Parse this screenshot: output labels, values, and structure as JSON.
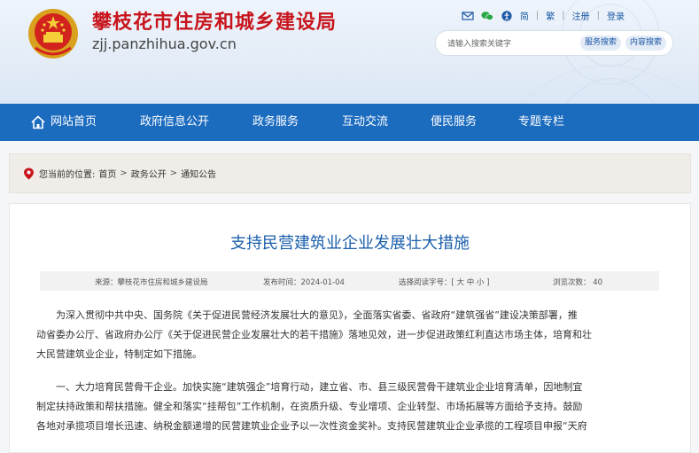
{
  "header": {
    "title": "攀枝花市住房和城乡建设局",
    "domain": "zjj.panzhihua.gov.cn",
    "links": {
      "simplified": "简",
      "traditional": "繁",
      "register": "注册",
      "login": "登录",
      "sep": "|"
    },
    "search": {
      "placeholder": "请输入搜索关键字",
      "service_search": "服务搜索",
      "content_search": "内容搜索"
    }
  },
  "nav": {
    "items": [
      {
        "label": "网站首页"
      },
      {
        "label": "政府信息公开"
      },
      {
        "label": "政务服务"
      },
      {
        "label": "互动交流"
      },
      {
        "label": "便民服务"
      },
      {
        "label": "专题专栏"
      }
    ]
  },
  "breadcrumb": {
    "prefix": "您当前的位置:",
    "items": [
      "首页",
      "政务公开",
      "通知公告"
    ],
    "sep": ">"
  },
  "article": {
    "title": "支持民营建筑业企业发展壮大措施",
    "meta": {
      "source": "来源：攀枝花市住房和城乡建设局",
      "published": "发布时间：2024-01-04",
      "font_size": "选择阅读字号：[ 大 中 小 ]",
      "views": "浏览次数： 40"
    },
    "paragraphs": [
      [
        "为深入贯彻中共中央、国务院《关于促进民营经济发展壮大的意见》，全面落实省委、省政府“建筑强省”建设决策部署，推",
        "动省委办公厅、省政府办公厅《关于促进民营企业发展壮大的若干措施》落地见效，进一步促进政策红利直达市场主体，培育和壮",
        "大民营建筑业企业，特制定如下措施。"
      ],
      [
        "一、大力培育民营骨干企业。加快实施“建筑强企”培育行动，建立省、市、县三级民营骨干建筑业企业培育清单，因地制宜",
        "制定扶持政策和帮扶措施。健全和落实“挂帮包”工作机制，在资质升级、专业增项、企业转型、市场拓展等方面给予支持。鼓励",
        "各地对承揽项目增长迅速、纳税金额递增的民营建筑业企业予以一次性资金奖补。支持民营建筑业企业承揽的工程项目申报“天府"
      ]
    ]
  },
  "colors": {
    "nav_bg": "#1b6bbf",
    "title_red": "#c8151d",
    "article_title": "#1b5fab"
  }
}
